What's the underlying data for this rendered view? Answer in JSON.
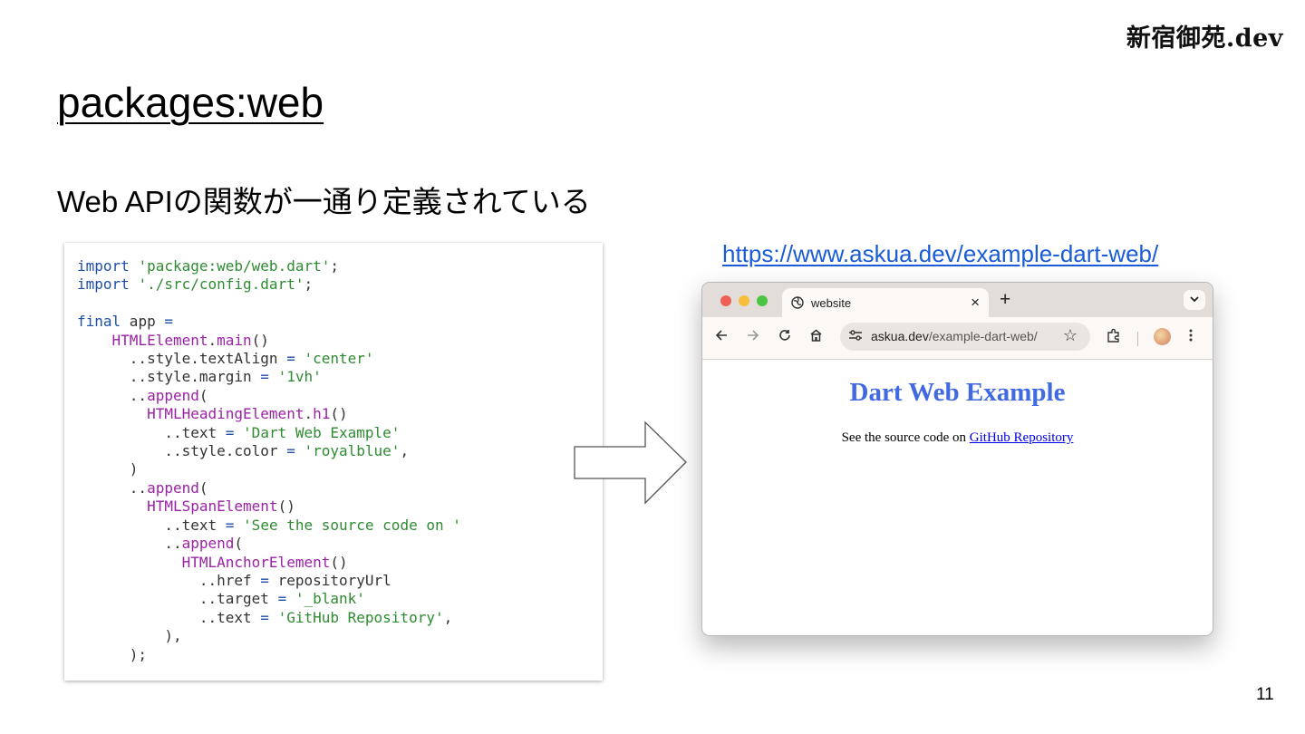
{
  "brand": "新宿御苑.dev",
  "slide": {
    "title": "packages:web",
    "subtitle": "Web APIの関数が一通り定義されている",
    "page_number": "11"
  },
  "code": {
    "lines": [
      [
        {
          "t": "import",
          "c": "kw"
        },
        {
          "t": " "
        },
        {
          "t": "'package:web/web.dart'",
          "c": "str"
        },
        {
          "t": ";"
        }
      ],
      [
        {
          "t": "import",
          "c": "kw"
        },
        {
          "t": " "
        },
        {
          "t": "'./src/config.dart'",
          "c": "str"
        },
        {
          "t": ";"
        }
      ],
      [],
      [
        {
          "t": "final",
          "c": "kw"
        },
        {
          "t": " app "
        },
        {
          "t": "=",
          "c": "op"
        }
      ],
      [
        {
          "t": "    "
        },
        {
          "t": "HTMLElement",
          "c": "cls"
        },
        {
          "t": "."
        },
        {
          "t": "main",
          "c": "cls"
        },
        {
          "t": "()"
        }
      ],
      [
        {
          "t": "      ..style.textAlign "
        },
        {
          "t": "=",
          "c": "op"
        },
        {
          "t": " "
        },
        {
          "t": "'center'",
          "c": "str"
        }
      ],
      [
        {
          "t": "      ..style.margin "
        },
        {
          "t": "=",
          "c": "op"
        },
        {
          "t": " "
        },
        {
          "t": "'1vh'",
          "c": "str"
        }
      ],
      [
        {
          "t": "      .."
        },
        {
          "t": "append",
          "c": "cls"
        },
        {
          "t": "("
        }
      ],
      [
        {
          "t": "        "
        },
        {
          "t": "HTMLHeadingElement",
          "c": "cls"
        },
        {
          "t": "."
        },
        {
          "t": "h1",
          "c": "cls"
        },
        {
          "t": "()"
        }
      ],
      [
        {
          "t": "          ..text "
        },
        {
          "t": "=",
          "c": "op"
        },
        {
          "t": " "
        },
        {
          "t": "'Dart Web Example'",
          "c": "str"
        }
      ],
      [
        {
          "t": "          ..style.color "
        },
        {
          "t": "=",
          "c": "op"
        },
        {
          "t": " "
        },
        {
          "t": "'royalblue'",
          "c": "str"
        },
        {
          "t": ","
        }
      ],
      [
        {
          "t": "      )"
        }
      ],
      [
        {
          "t": "      .."
        },
        {
          "t": "append",
          "c": "cls"
        },
        {
          "t": "("
        }
      ],
      [
        {
          "t": "        "
        },
        {
          "t": "HTMLSpanElement",
          "c": "cls"
        },
        {
          "t": "()"
        }
      ],
      [
        {
          "t": "          ..text "
        },
        {
          "t": "=",
          "c": "op"
        },
        {
          "t": " "
        },
        {
          "t": "'See the source code on '",
          "c": "str"
        }
      ],
      [
        {
          "t": "          .."
        },
        {
          "t": "append",
          "c": "cls"
        },
        {
          "t": "("
        }
      ],
      [
        {
          "t": "            "
        },
        {
          "t": "HTMLAnchorElement",
          "c": "cls"
        },
        {
          "t": "()"
        }
      ],
      [
        {
          "t": "              ..href "
        },
        {
          "t": "=",
          "c": "op"
        },
        {
          "t": " repositoryUrl"
        }
      ],
      [
        {
          "t": "              ..target "
        },
        {
          "t": "=",
          "c": "op"
        },
        {
          "t": " "
        },
        {
          "t": "'_blank'",
          "c": "str"
        }
      ],
      [
        {
          "t": "              ..text "
        },
        {
          "t": "=",
          "c": "op"
        },
        {
          "t": " "
        },
        {
          "t": "'GitHub Repository'",
          "c": "str"
        },
        {
          "t": ","
        }
      ],
      [
        {
          "t": "          ),"
        }
      ],
      [
        {
          "t": "      );"
        }
      ]
    ]
  },
  "link_url": "https://www.askua.dev/example-dart-web/",
  "browser": {
    "tab_title": "website",
    "tab_icon": "globe-icon",
    "tab_close": "×",
    "new_tab": "+",
    "tab_menu": "⌄",
    "address_domain": "askua.dev",
    "address_path": "/example-dart-web/",
    "page_heading": "Dart Web Example",
    "page_text": "See the source code on ",
    "page_link": "GitHub Repository",
    "heading_color": "#4169e1"
  },
  "colors": {
    "mac_close": "#ee5f57",
    "mac_minimize": "#f6be3b",
    "mac_maximize": "#4bc441",
    "link": "#1a5bd8"
  }
}
